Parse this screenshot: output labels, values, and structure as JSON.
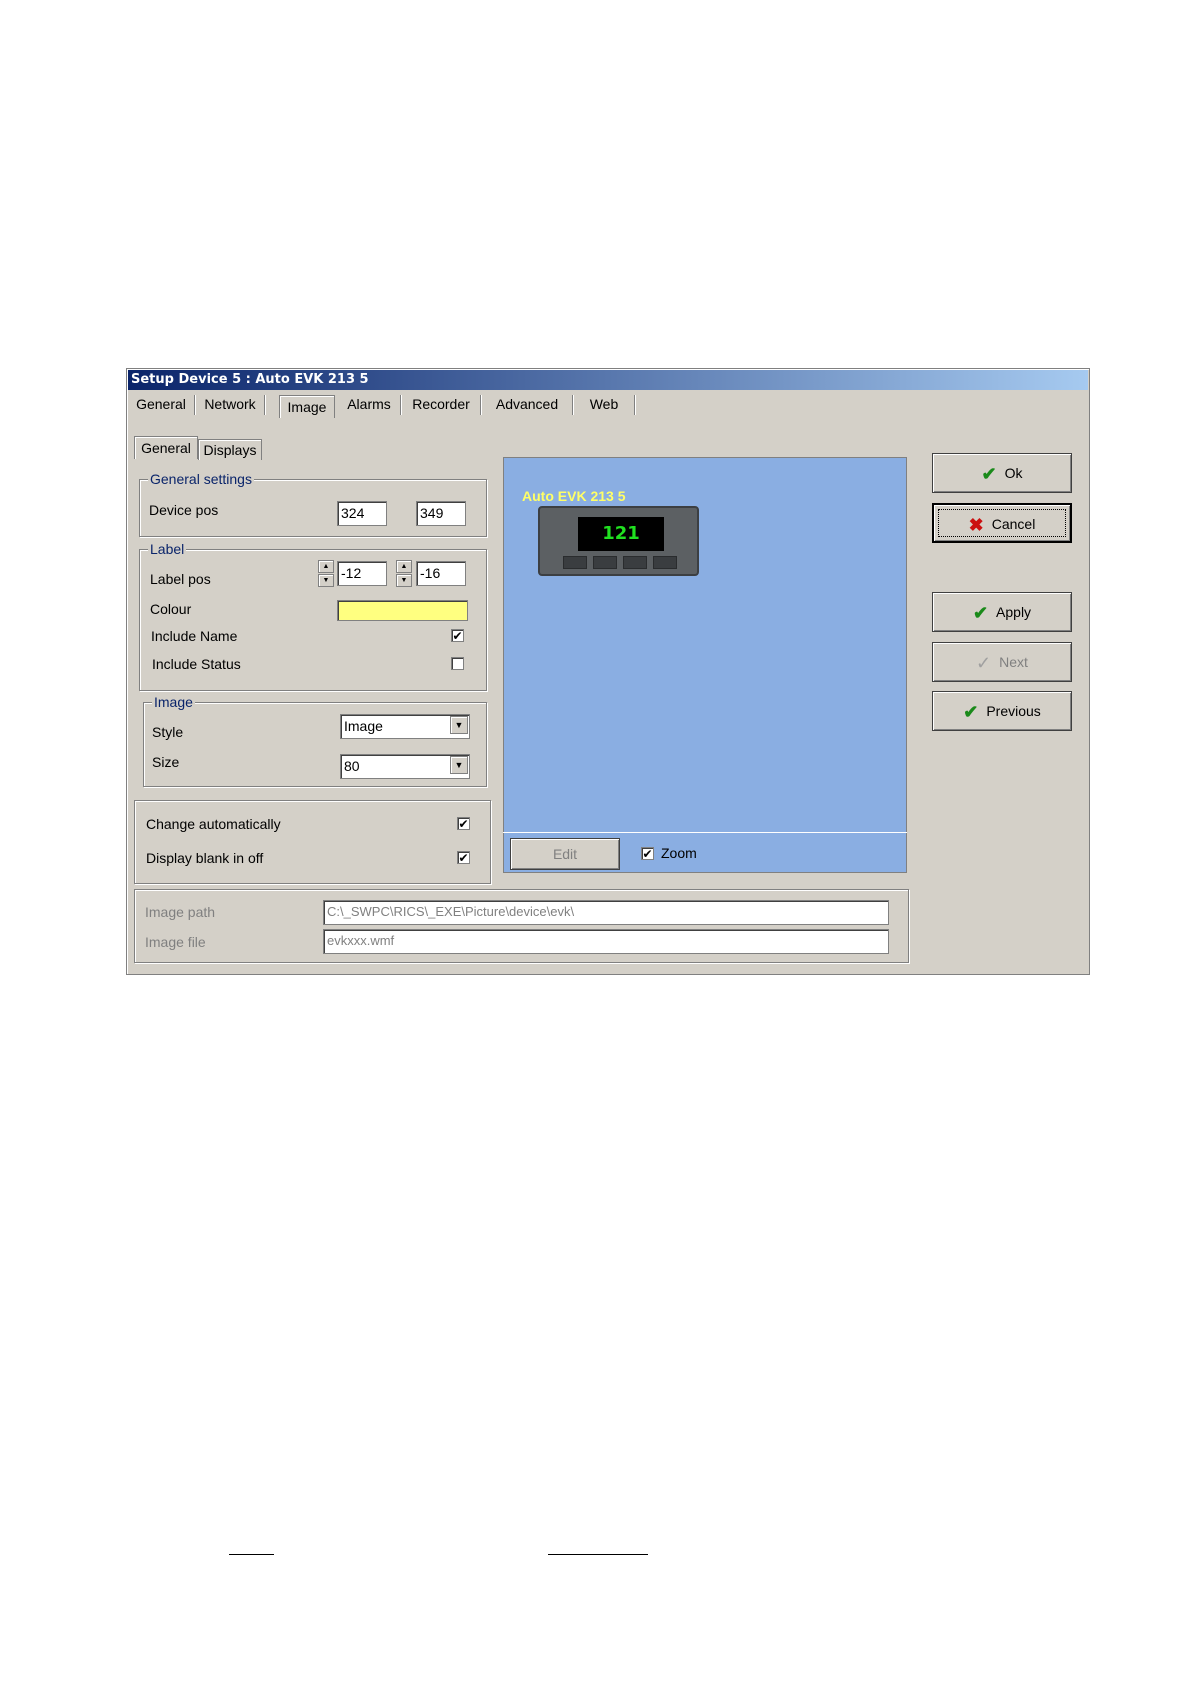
{
  "dialog": {
    "title": "Setup Device 5 : Auto EVK 213 5",
    "tabs": [
      "General",
      "Network",
      "Image",
      "Alarms",
      "Recorder",
      "Advanced",
      "Web"
    ],
    "active_tab": "Image",
    "subtabs": [
      "General",
      "Displays"
    ],
    "active_subtab": "General"
  },
  "general_settings": {
    "legend": "General settings",
    "device_pos_label": "Device pos",
    "device_pos_x": "324",
    "device_pos_y": "349"
  },
  "label_group": {
    "legend": "Label",
    "label_pos_label": "Label pos",
    "label_pos_x": "-12",
    "label_pos_y": "-16",
    "colour_label": "Colour",
    "colour_value": "#ffff80",
    "include_name_label": "Include Name",
    "include_name_checked": true,
    "include_status_label": "Include Status",
    "include_status_checked": false
  },
  "image_group": {
    "legend": "Image",
    "style_label": "Style",
    "style_value": "Image",
    "size_label": "Size",
    "size_value": "80"
  },
  "options": {
    "change_automatically_label": "Change automatically",
    "change_automatically_checked": true,
    "display_blank_label": "Display blank in off",
    "display_blank_checked": true
  },
  "preview": {
    "device_label": "Auto EVK 213 5",
    "display_value": "121",
    "background_color": "#8aaee2",
    "edit_label": "Edit",
    "zoom_label": "Zoom",
    "zoom_checked": true
  },
  "paths": {
    "image_path_label": "Image path",
    "image_path_value": "C:\\_SWPC\\RICS\\_EXE\\Picture\\device\\evk\\",
    "image_file_label": "Image file",
    "image_file_value": "evkxxx.wmf"
  },
  "buttons": {
    "ok": "Ok",
    "cancel": "Cancel",
    "apply": "Apply",
    "next": "Next",
    "previous": "Previous"
  },
  "colors": {
    "titlebar": "#0a246a",
    "dialog_bg": "#d4d0c8",
    "check_green": "#1a8a1a",
    "cancel_red": "#cc1010",
    "device_label_yellow": "#ffff66"
  }
}
